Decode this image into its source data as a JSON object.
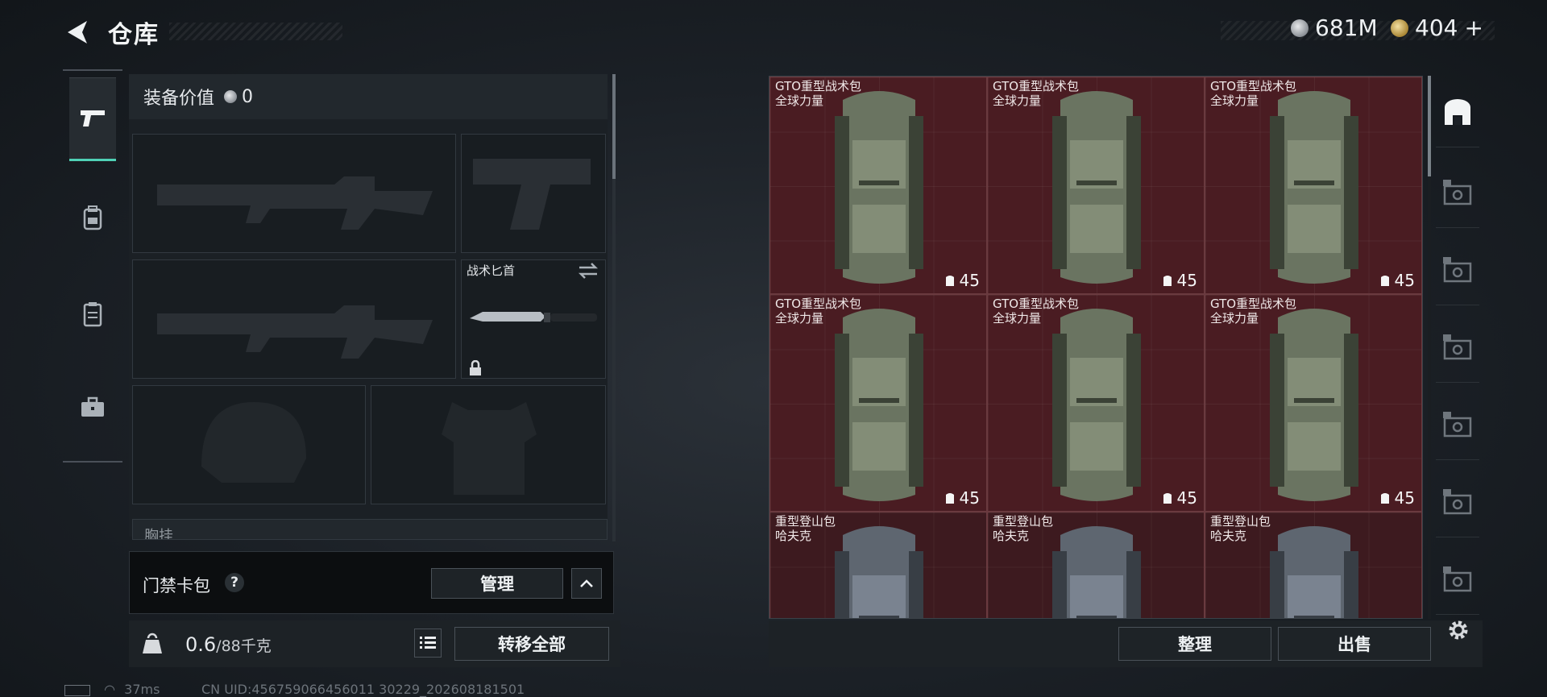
{
  "header": {
    "title": "仓库"
  },
  "currency": {
    "silver": "681M",
    "gold": "404",
    "gold_add": "+"
  },
  "nav": [
    "pistol-icon",
    "backpack-icon",
    "armor-vest-icon",
    "toolbox-icon"
  ],
  "equipment": {
    "value_label": "装备价值",
    "value": "0",
    "knife_label": "战术匕首",
    "chest_label": "胸挂"
  },
  "access_card": {
    "label": "门禁卡包",
    "help": "?",
    "manage": "管理"
  },
  "weight": {
    "current": "0.6",
    "max": "/88千克",
    "icon_label": "KG",
    "transfer_all": "转移全部"
  },
  "grid_items": [
    {
      "name": "GTO重型战术包",
      "brand": "全球力量",
      "qty": "45",
      "type": "green"
    },
    {
      "name": "GTO重型战术包",
      "brand": "全球力量",
      "qty": "45",
      "type": "green"
    },
    {
      "name": "GTO重型战术包",
      "brand": "全球力量",
      "qty": "45",
      "type": "green"
    },
    {
      "name": "GTO重型战术包",
      "brand": "全球力量",
      "qty": "45",
      "type": "green"
    },
    {
      "name": "GTO重型战术包",
      "brand": "全球力量",
      "qty": "45",
      "type": "green"
    },
    {
      "name": "GTO重型战术包",
      "brand": "全球力量",
      "qty": "45",
      "type": "green"
    },
    {
      "name": "重型登山包",
      "brand": "哈夫克",
      "qty": "",
      "type": "gray"
    },
    {
      "name": "重型登山包",
      "brand": "哈夫克",
      "qty": "",
      "type": "gray"
    },
    {
      "name": "重型登山包",
      "brand": "哈夫克",
      "qty": "",
      "type": "gray"
    }
  ],
  "side_tools": [
    "helmet-icon",
    "v-case-icon",
    "v-case-icon",
    "v-case-icon",
    "v-case-icon",
    "gm-case-icon",
    "iv-case-icon"
  ],
  "actions": {
    "sort": "整理",
    "sell": "出售"
  },
  "status": {
    "ping": "37ms",
    "uid": "CN UID:456759066456011 30229_202608181501"
  }
}
